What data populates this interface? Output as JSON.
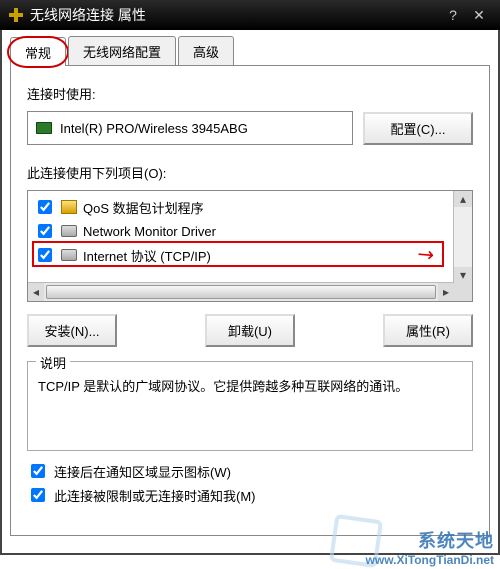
{
  "window": {
    "title": "无线网络连接 属性"
  },
  "tabs": {
    "general": "常规",
    "wireless": "无线网络配置",
    "advanced": "高级"
  },
  "adapter": {
    "label": "连接时使用:",
    "name": "Intel(R) PRO/Wireless 3945ABG",
    "config_btn": "配置(C)..."
  },
  "items": {
    "label": "此连接使用下列项目(O):",
    "list": [
      {
        "label": "QoS 数据包计划程序",
        "checked": true,
        "icon": "qos"
      },
      {
        "label": "Network Monitor Driver",
        "checked": true,
        "icon": "net"
      },
      {
        "label": "Internet 协议 (TCP/IP)",
        "checked": true,
        "icon": "tcp"
      }
    ]
  },
  "buttons": {
    "install": "安装(N)...",
    "uninstall": "卸载(U)",
    "properties": "属性(R)"
  },
  "description": {
    "legend": "说明",
    "text": "TCP/IP 是默认的广域网协议。它提供跨越多种互联网络的通讯。"
  },
  "notify": {
    "show_icon": "连接后在通知区域显示图标(W)",
    "limited": "此连接被限制或无连接时通知我(M)"
  },
  "watermark": {
    "cn": "系统天地",
    "url": "www.XiTongTianDi.net"
  }
}
